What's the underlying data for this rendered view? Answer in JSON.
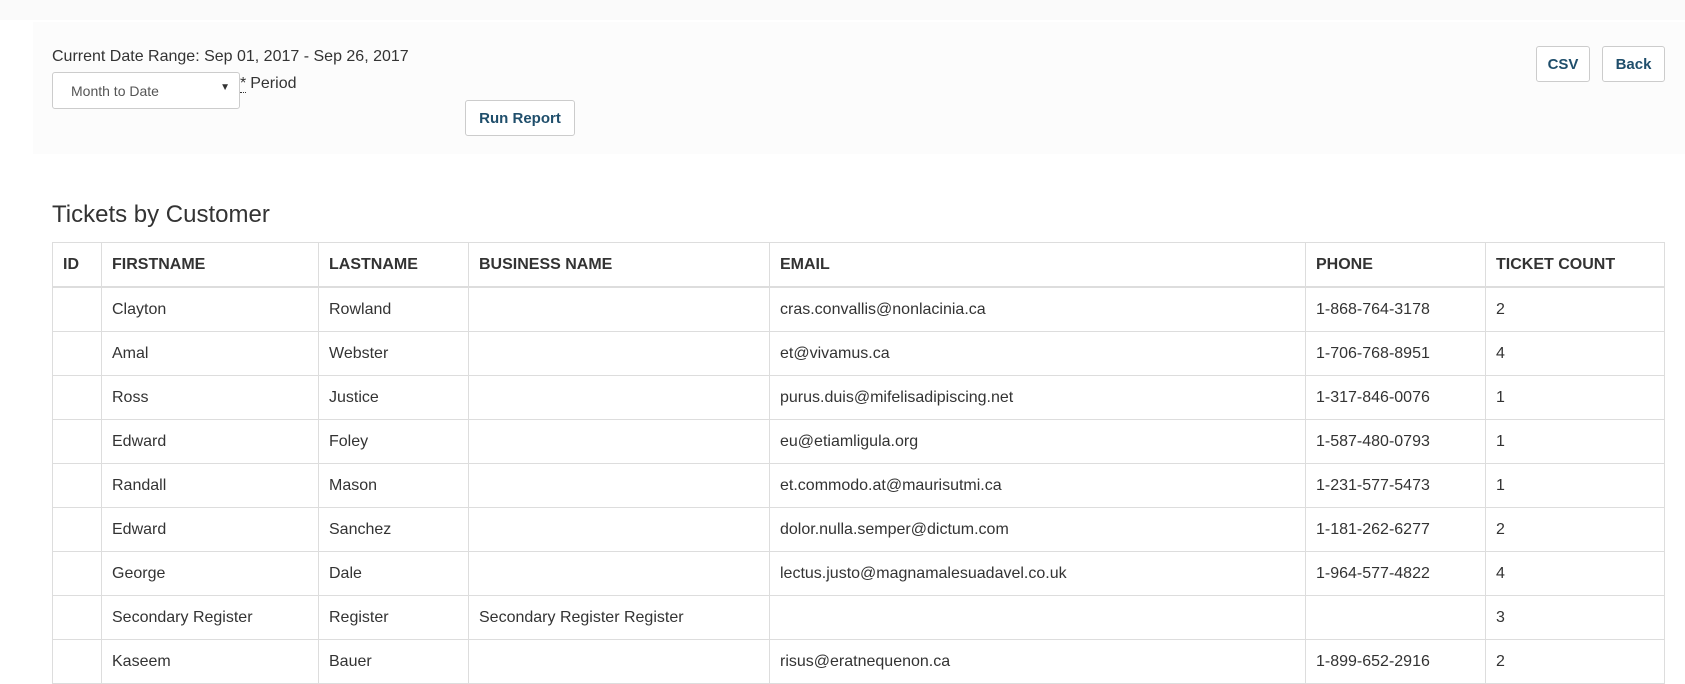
{
  "filter": {
    "date_range_label": "Current Date Range: Sep 01, 2017 - Sep 26, 2017",
    "period_select_value": "Month to Date",
    "period_required_mark": "*",
    "period_label": "Period",
    "run_report_label": "Run Report"
  },
  "toolbar": {
    "csv_label": "CSV",
    "back_label": "Back"
  },
  "report": {
    "title": "Tickets by Customer",
    "columns": [
      "ID",
      "FIRSTNAME",
      "LASTNAME",
      "BUSINESS NAME",
      "EMAIL",
      "PHONE",
      "TICKET COUNT"
    ],
    "rows": [
      [
        "",
        "Clayton",
        "Rowland",
        "",
        "cras.convallis@nonlacinia.ca",
        "1-868-764-3178",
        "2"
      ],
      [
        "",
        "Amal",
        "Webster",
        "",
        "et@vivamus.ca",
        "1-706-768-8951",
        "4"
      ],
      [
        "",
        "Ross",
        "Justice",
        "",
        "purus.duis@mifelisadipiscing.net",
        "1-317-846-0076",
        "1"
      ],
      [
        "",
        "Edward",
        "Foley",
        "",
        "eu@etiamligula.org",
        "1-587-480-0793",
        "1"
      ],
      [
        "",
        "Randall",
        "Mason",
        "",
        "et.commodo.at@maurisutmi.ca",
        "1-231-577-5473",
        "1"
      ],
      [
        "",
        "Edward",
        "Sanchez",
        "",
        "dolor.nulla.semper@dictum.com",
        "1-181-262-6277",
        "2"
      ],
      [
        "",
        "George",
        "Dale",
        "",
        "lectus.justo@magnamalesuadavel.co.uk",
        "1-964-577-4822",
        "4"
      ],
      [
        "",
        "Secondary Register",
        "Register",
        "Secondary Register Register",
        "",
        "",
        "3"
      ],
      [
        "",
        "Kaseem",
        "Bauer",
        "",
        "risus@eratnequenon.ca",
        "1-899-652-2916",
        "2"
      ]
    ]
  }
}
